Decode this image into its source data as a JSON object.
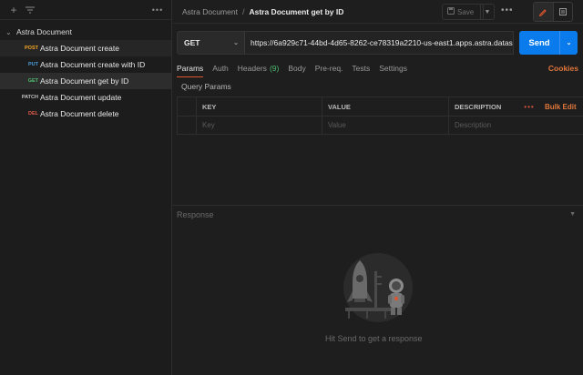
{
  "sidebar": {
    "add_icon": "plus-icon",
    "filter_icon": "filter-icon",
    "more_icon": "more-horizontal-icon",
    "collection": {
      "name": "Astra Document",
      "chevron_icon": "chevron-down-icon"
    },
    "requests": [
      {
        "method": "POST",
        "name": "Astra Document create",
        "method_color": "#f5a623"
      },
      {
        "method": "PUT",
        "name": "Astra Document create with ID",
        "method_color": "#4a9fe0"
      },
      {
        "method": "GET",
        "name": "Astra Document get by ID",
        "method_color": "#4fbf72"
      },
      {
        "method": "PATCH",
        "name": "Astra Document update",
        "method_color": "#c0c0c0"
      },
      {
        "method": "DEL",
        "name": "Astra Document delete",
        "method_color": "#e05a4a"
      }
    ]
  },
  "header": {
    "breadcrumb_parent": "Astra Document",
    "breadcrumb_sep": "/",
    "breadcrumb_current": "Astra Document get by ID",
    "save_label": "Save",
    "save_icon": "save-icon",
    "more_icon": "more-horizontal-icon",
    "edit_icon": "pencil-icon",
    "docs_icon": "document-icon"
  },
  "request": {
    "method": "GET",
    "url": "https://6a929c71-44bd-4d65-8262-ce78319a2210-us-east1.apps.astra.datas",
    "send_label": "Send"
  },
  "tabs": {
    "items": [
      {
        "label": "Params",
        "active": true
      },
      {
        "label": "Auth"
      },
      {
        "label": "Headers",
        "count": "(9)"
      },
      {
        "label": "Body"
      },
      {
        "label": "Pre-req."
      },
      {
        "label": "Tests"
      },
      {
        "label": "Settings"
      }
    ],
    "cookies_label": "Cookies"
  },
  "params": {
    "title": "Query Params",
    "headers": {
      "key": "KEY",
      "value": "VALUE",
      "description": "DESCRIPTION",
      "more": "•••",
      "bulk_edit": "Bulk Edit"
    },
    "placeholders": {
      "key": "Key",
      "value": "Value",
      "description": "Description"
    }
  },
  "response": {
    "label": "Response",
    "empty_text": "Hit Send to get a response",
    "illustration_icon": "rocket-astronaut-illustration"
  },
  "colors": {
    "accent": "#e0562c",
    "send_blue": "#097bed",
    "get_green": "#4fbf72"
  }
}
